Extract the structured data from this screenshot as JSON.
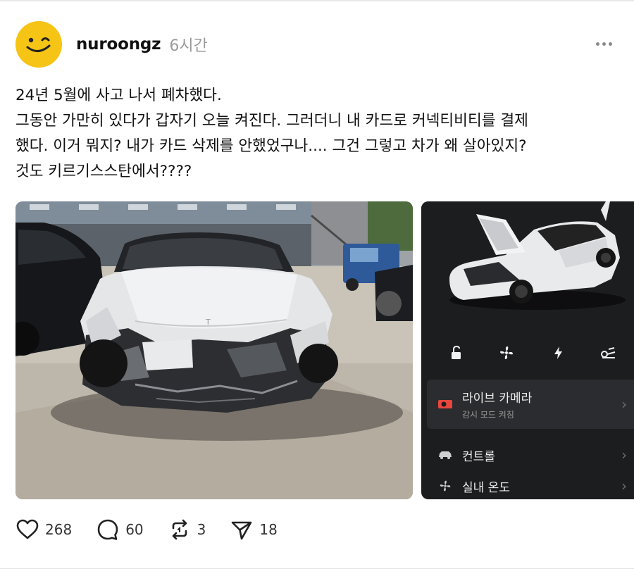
{
  "post": {
    "username": "nuroongz",
    "time": "6시간",
    "text_lines": [
      "24년 5월에 사고 나서 폐차했다.",
      "그동안 가만히 있다가 갑자기 오늘 켜진다. 그러더니 내 카드로 커넥티비티를 결제",
      "했다. 이거 뭐지? 내가 카드 삭제를 안했었구나.... 그건 그렇고 차가 왜 살아있지?",
      "것도 키르기스스탄에서????"
    ]
  },
  "app_screenshot": {
    "live_camera_label": "라이브 카메라",
    "live_camera_sub": "감시 모드 켜짐",
    "controls_label": "컨트롤",
    "climate_label": "실내 온도",
    "accent_color": "#e8463c",
    "quick_icons": [
      "unlock-icon",
      "fan-icon",
      "bolt-icon",
      "wiper-icon"
    ]
  },
  "actions": {
    "likes": "268",
    "comments": "60",
    "reposts": "3",
    "shares": "18"
  },
  "colors": {
    "avatar": "#f6c414",
    "app_bg": "#1c1d1f"
  }
}
